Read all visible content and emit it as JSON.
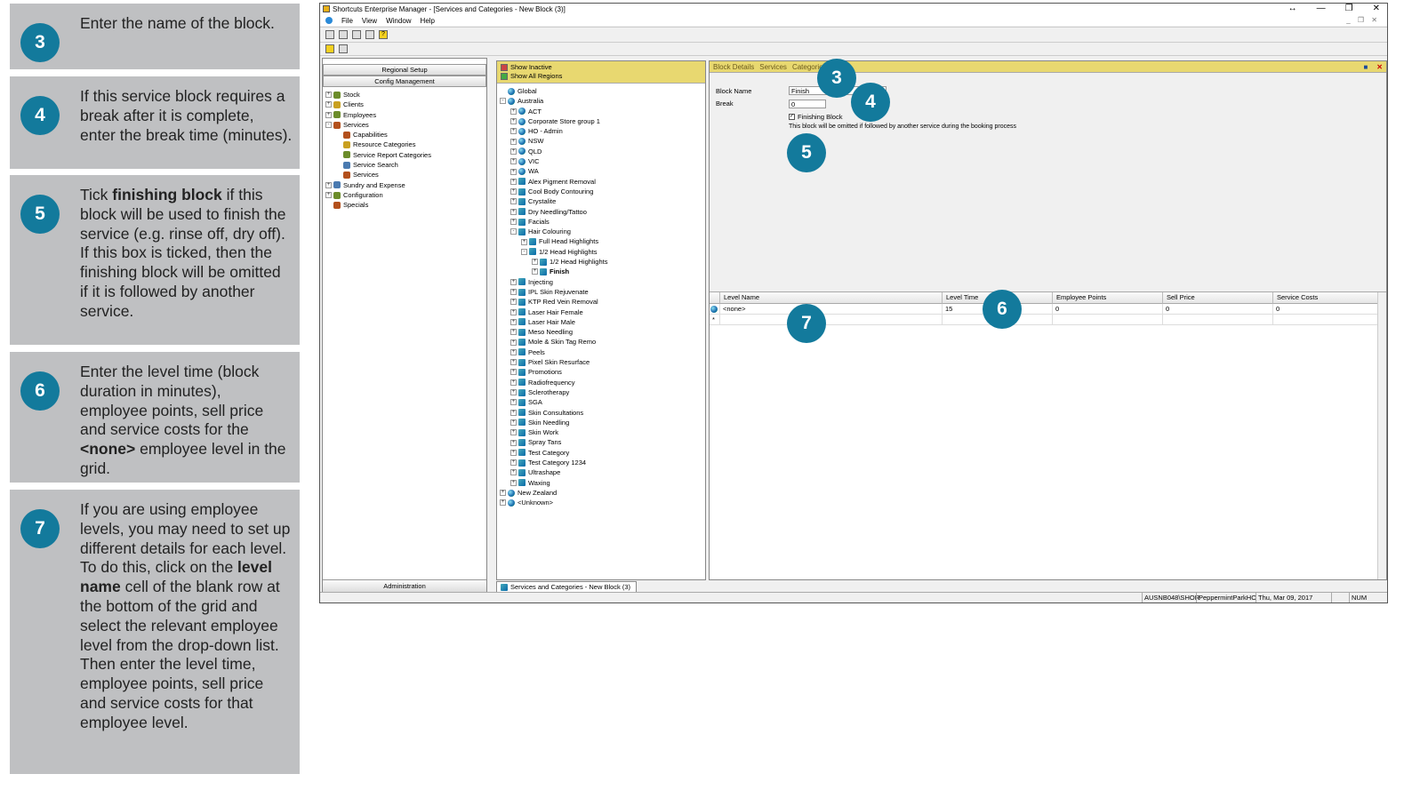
{
  "instructions": [
    {
      "num": "3",
      "text_html": "Enter the name of the block."
    },
    {
      "num": "4",
      "text_html": "If this service block requires a break after it is complete, enter the break time (minutes)."
    },
    {
      "num": "5",
      "text_html": "Tick <b>finishing block</b> if this block will be used to finish the service (e.g. rinse off, dry off). If this box is ticked, then the finishing block will be omitted if it is followed by another service."
    },
    {
      "num": "6",
      "text_html": "Enter the level time (block duration in minutes), employee points, sell price and service costs for the <b>&lt;none&gt;</b> employee level in the grid."
    },
    {
      "num": "7",
      "text_html": "If you are using employee levels, you may need to set up different details for each level. To do this, click on the <b>level name</b> cell of the blank row at the bottom of the grid and select the relevant employee level from the drop-down list. Then enter the level time, employee points, sell price and service costs for that employee level."
    }
  ],
  "window": {
    "title": "Shortcuts Enterprise Manager - [Services and Categories - New Block (3)]",
    "controls": [
      "↔",
      "—",
      "❐",
      "✕"
    ]
  },
  "menu": [
    "File",
    "View",
    "Window",
    "Help"
  ],
  "left": {
    "buttons": [
      "Regional Setup",
      "Config Management"
    ],
    "admin": "Administration",
    "tree": [
      {
        "label": "Stock",
        "lvl": 0,
        "pm": "+"
      },
      {
        "label": "Clients",
        "lvl": 0,
        "pm": "+"
      },
      {
        "label": "Employees",
        "lvl": 0,
        "pm": "+"
      },
      {
        "label": "Services",
        "lvl": 0,
        "pm": "-"
      },
      {
        "label": "Capabilities",
        "lvl": 1,
        "pm": ""
      },
      {
        "label": "Resource Categories",
        "lvl": 1,
        "pm": ""
      },
      {
        "label": "Service Report Categories",
        "lvl": 1,
        "pm": ""
      },
      {
        "label": "Service Search",
        "lvl": 1,
        "pm": ""
      },
      {
        "label": "Services",
        "lvl": 1,
        "pm": ""
      },
      {
        "label": "Sundry and Expense",
        "lvl": 0,
        "pm": "+"
      },
      {
        "label": "Configuration",
        "lvl": 0,
        "pm": "+"
      },
      {
        "label": "Specials",
        "lvl": 0,
        "pm": ""
      }
    ]
  },
  "mid": {
    "show_inactive": "Show Inactive",
    "show_all": "Show All Regions",
    "tab": "Services and Categories - New Block (3)",
    "tree": [
      {
        "label": "Global",
        "lvl": 0,
        "pm": "",
        "ic": "globe"
      },
      {
        "label": "Australia",
        "lvl": 0,
        "pm": "-",
        "ic": "globe"
      },
      {
        "label": "ACT",
        "lvl": 1,
        "pm": "+",
        "ic": "globe"
      },
      {
        "label": "Corporate Store group 1",
        "lvl": 1,
        "pm": "+",
        "ic": "globe"
      },
      {
        "label": "HO - Admin",
        "lvl": 1,
        "pm": "+",
        "ic": "globe"
      },
      {
        "label": "NSW",
        "lvl": 1,
        "pm": "+",
        "ic": "globe"
      },
      {
        "label": "QLD",
        "lvl": 1,
        "pm": "+",
        "ic": "globe"
      },
      {
        "label": "VIC",
        "lvl": 1,
        "pm": "+",
        "ic": "globe"
      },
      {
        "label": "WA",
        "lvl": 1,
        "pm": "+",
        "ic": "globe"
      },
      {
        "label": "Alex Pigment Removal",
        "lvl": 1,
        "pm": "+",
        "ic": "book"
      },
      {
        "label": "Cool Body Contouring",
        "lvl": 1,
        "pm": "+",
        "ic": "book"
      },
      {
        "label": "Crystalite",
        "lvl": 1,
        "pm": "+",
        "ic": "book"
      },
      {
        "label": "Dry Needling/Tattoo",
        "lvl": 1,
        "pm": "+",
        "ic": "book"
      },
      {
        "label": "Facials",
        "lvl": 1,
        "pm": "+",
        "ic": "book"
      },
      {
        "label": "Hair Colouring",
        "lvl": 1,
        "pm": "-",
        "ic": "book"
      },
      {
        "label": "Full Head Highlights",
        "lvl": 2,
        "pm": "+",
        "ic": "book"
      },
      {
        "label": "1/2 Head Highlights",
        "lvl": 2,
        "pm": "-",
        "ic": "book"
      },
      {
        "label": "1/2 Head Highlights",
        "lvl": 3,
        "pm": "+",
        "ic": "book"
      },
      {
        "label": "Finish",
        "lvl": 3,
        "pm": "+",
        "ic": "book",
        "bold": true
      },
      {
        "label": "Injecting",
        "lvl": 1,
        "pm": "+",
        "ic": "book"
      },
      {
        "label": "IPL Skin Rejuvenate",
        "lvl": 1,
        "pm": "+",
        "ic": "book"
      },
      {
        "label": "KTP Red Vein Removal",
        "lvl": 1,
        "pm": "+",
        "ic": "book"
      },
      {
        "label": "Laser Hair Female",
        "lvl": 1,
        "pm": "+",
        "ic": "book"
      },
      {
        "label": "Laser Hair Male",
        "lvl": 1,
        "pm": "+",
        "ic": "book"
      },
      {
        "label": "Meso Needling",
        "lvl": 1,
        "pm": "+",
        "ic": "book"
      },
      {
        "label": "Mole & Skin Tag Remo",
        "lvl": 1,
        "pm": "+",
        "ic": "book"
      },
      {
        "label": "Peels",
        "lvl": 1,
        "pm": "+",
        "ic": "book"
      },
      {
        "label": "Pixel Skin Resurface",
        "lvl": 1,
        "pm": "+",
        "ic": "book"
      },
      {
        "label": "Promotions",
        "lvl": 1,
        "pm": "+",
        "ic": "book"
      },
      {
        "label": "Radiofrequency",
        "lvl": 1,
        "pm": "+",
        "ic": "book"
      },
      {
        "label": "Sclerotherapy",
        "lvl": 1,
        "pm": "+",
        "ic": "book"
      },
      {
        "label": "SGA",
        "lvl": 1,
        "pm": "+",
        "ic": "book"
      },
      {
        "label": "Skin Consultations",
        "lvl": 1,
        "pm": "+",
        "ic": "book"
      },
      {
        "label": "Skin Needling",
        "lvl": 1,
        "pm": "+",
        "ic": "book"
      },
      {
        "label": "Skin Work",
        "lvl": 1,
        "pm": "+",
        "ic": "book"
      },
      {
        "label": "Spray Tans",
        "lvl": 1,
        "pm": "+",
        "ic": "book"
      },
      {
        "label": "Test Category",
        "lvl": 1,
        "pm": "+",
        "ic": "book"
      },
      {
        "label": "Test Category 1234",
        "lvl": 1,
        "pm": "+",
        "ic": "book"
      },
      {
        "label": "Ultrashape",
        "lvl": 1,
        "pm": "+",
        "ic": "book"
      },
      {
        "label": "Waxing",
        "lvl": 1,
        "pm": "+",
        "ic": "book"
      },
      {
        "label": "New Zealand",
        "lvl": 0,
        "pm": "+",
        "ic": "globe"
      },
      {
        "label": "<Unknown>",
        "lvl": 0,
        "pm": "+",
        "ic": "globe"
      }
    ]
  },
  "right": {
    "tabs": [
      "Block Details",
      "Services",
      "Categories"
    ],
    "block_name_label": "Block Name",
    "block_name": "Finish",
    "break_label": "Break",
    "break": "0",
    "finishing_label": "Finishing Block",
    "finishing_checked": true,
    "note": "This block will be omitted if followed by another service during the booking process",
    "grid_headers": [
      "Level Name",
      "Level Time",
      "Employee Points",
      "Sell Price",
      "Service Costs"
    ],
    "row": [
      "<none>",
      "15",
      "0",
      "0",
      "0"
    ],
    "new_row_marker": "*"
  },
  "status": [
    "AUSNB048\\SHOR",
    "PeppermintParkHO",
    "Thu, Mar 09, 2017",
    "",
    "NUM"
  ],
  "callouts": [
    "3",
    "4",
    "5",
    "6",
    "7"
  ]
}
